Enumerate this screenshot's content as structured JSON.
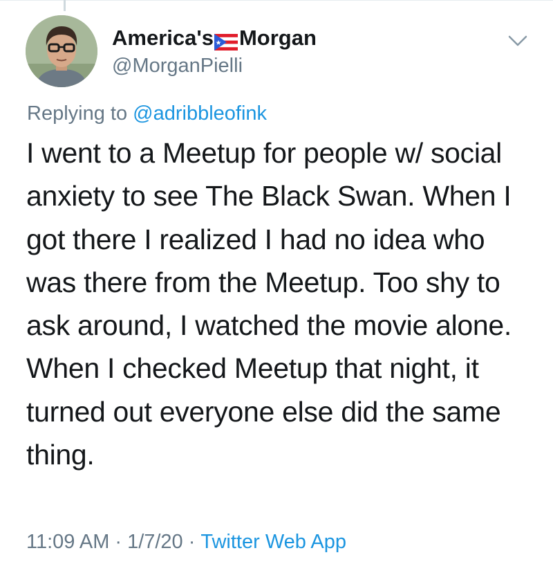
{
  "author": {
    "display_name_before": "America's",
    "display_name_after": "Morgan",
    "flag_emoji": "puerto-rico-flag-icon",
    "handle": "@MorganPielli"
  },
  "reply": {
    "prefix": "Replying to",
    "mention": "@adribbleofink"
  },
  "tweet": {
    "lines": [
      "I went to a Meetup for people w/ social",
      "anxiety to see The Black Swan. When I",
      "got there I realized I had no idea who",
      "was there from the Meetup. Too shy to",
      "ask around, I watched the movie alone.",
      "When I checked Meetup that night, it",
      "turned out everyone else did the same",
      "thing."
    ]
  },
  "meta": {
    "time": "11:09 AM",
    "separator": "·",
    "date": "1/7/20",
    "source": "Twitter Web App"
  },
  "colors": {
    "text": "#14171a",
    "secondary": "#657786",
    "link": "#1b95e0"
  }
}
